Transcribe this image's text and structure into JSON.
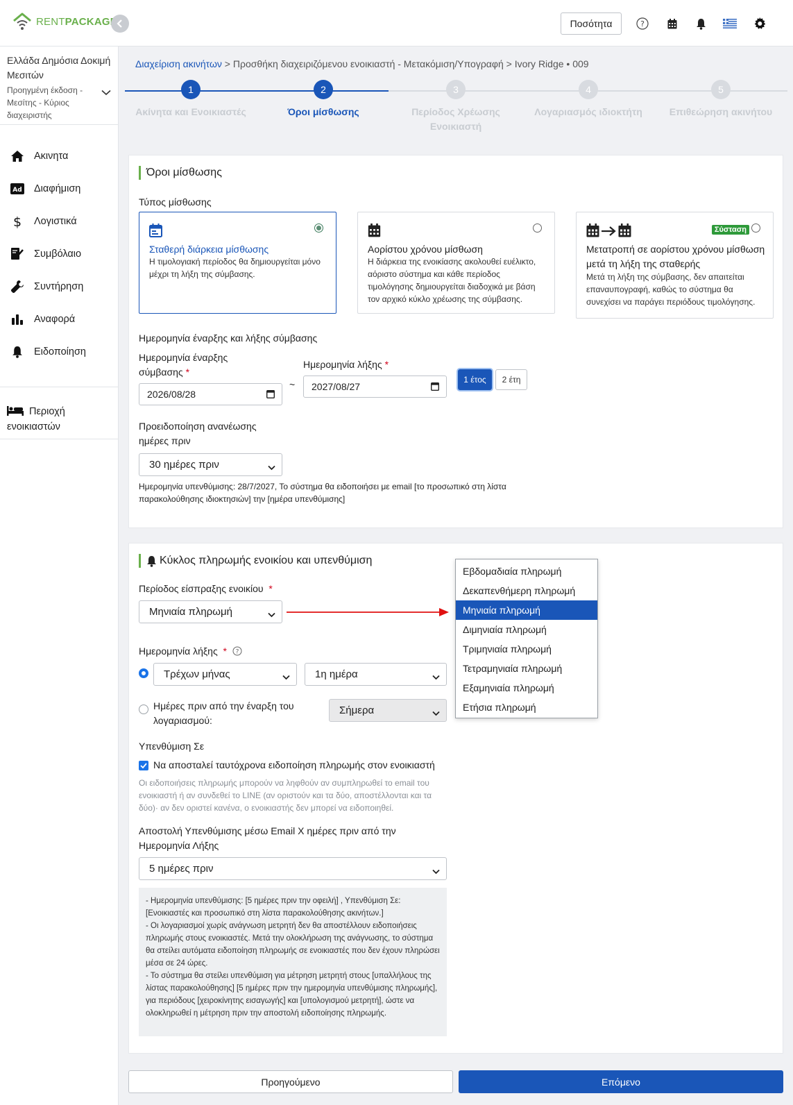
{
  "brand": {
    "rent": "RENT",
    "package": "PACKAGE"
  },
  "topbar": {
    "quantity_label": "Ποσότητα"
  },
  "sidebar": {
    "org_name": "Ελλάδα Δημόσια Δοκιμή Μεσιτών",
    "org_role": "Προηγμένη έκδοση - Μεσίτης - Κύριος διαχειριστής",
    "items": [
      {
        "label": "Ακινητα",
        "icon": "home-icon"
      },
      {
        "label": "Διαφήμιση",
        "icon": "ad-icon"
      },
      {
        "label": "Λογιστικά",
        "icon": "dollar-icon"
      },
      {
        "label": "Συμβόλαιο",
        "icon": "contract-icon"
      },
      {
        "label": "Συντήρηση",
        "icon": "wrench-icon"
      },
      {
        "label": "Αναφορά",
        "icon": "chart-icon"
      },
      {
        "label": "Ειδοποίηση",
        "icon": "bell-icon"
      }
    ],
    "tenant_area": "Περιοχή ενοικιαστών"
  },
  "breadcrumb": {
    "root": "Διαχείριση ακινήτων",
    "sep1": ">",
    "middle": "Προσθήκη διαχειριζόμενου ενοικιαστή - Μετακόμιση/Υπογραφή",
    "sep2": ">",
    "current": "Ivory Ridge • 009"
  },
  "stepper": {
    "steps": [
      {
        "number": "1",
        "label": "Ακίνητα και Ενοικιαστές"
      },
      {
        "number": "2",
        "label": "Όροι μίσθωσης"
      },
      {
        "number": "3",
        "label": "Περίοδος Χρέωσης Ενοικιαστή"
      },
      {
        "number": "4",
        "label": "Λογαριασμός ιδιοκτήτη"
      },
      {
        "number": "5",
        "label": "Επιθεώρηση ακινήτου"
      }
    ]
  },
  "lease": {
    "title": "Όροι μίσθωσης",
    "type_label": "Τύπος μίσθωσης",
    "options": [
      {
        "title": "Σταθερή διάρκεια μίσθωσης",
        "desc": "Η τιμολογιακή περίοδος θα δημιουργείται μόνο μέχρι τη λήξη της σύμβασης."
      },
      {
        "title": "Αορίστου χρόνου μίσθωση",
        "desc": "Η διάρκεια της ενοικίασης ακολουθεί ευέλικτο, αόριστο σύστημα και κάθε περίοδος τιμολόγησης δημιουργείται διαδοχικά με βάση τον αρχικό κύκλο χρέωσης της σύμβασης."
      },
      {
        "title": "Μετατροπή σε αορίστου χρόνου μίσθωση μετά τη λήξη της σταθερής",
        "desc": "Μετά τη λήξη της σύμβασης, δεν απαιτείται επαναυπογραφή, καθώς το σύστημα θα συνεχίσει να παράγει περιόδους τιμολόγησης.",
        "badge": "Σύσταση"
      }
    ],
    "dates_heading": "Ημερομηνία έναρξης και λήξης σύμβασης",
    "start_label": "Ημερομηνία έναρξης σύμβασης",
    "start_value": "2026/08/28",
    "tilde": "~",
    "end_label": "Ημερομηνία λήξης",
    "end_value": "2027/08/27",
    "year1": "1 έτος",
    "year2": "2 έτη",
    "renewal_label": "Προειδοποίηση ανανέωσης ημέρες πριν",
    "renewal_value": "30 ημέρες πριν",
    "renewal_note": "Ημερομηνία υπενθύμισης: 28/7/2027, Το σύστημα θα ειδοποιήσει με email [το προσωπικό στη λίστα παρακολούθησης ιδιοκτησιών] την [ημέρα υπενθύμισης]"
  },
  "payment": {
    "title": "Κύκλος πληρωμής ενοικίου και υπενθύμιση",
    "period_label": "Περίοδος είσπραξης ενοικίου",
    "period_value": "Μηνιαία πληρωμή",
    "due_label": "Ημερομηνία λήξης",
    "month_value": "Τρέχων μήνας",
    "day_value": "1η ημέρα",
    "before_label": "Ημέρες πριν από την έναρξη του λογαριασμού:",
    "before_value": "Σήμερα",
    "remind_label": "Υπενθύμιση Σε",
    "check_label": "Να αποσταλεί ταυτόχρονα ειδοποίηση πληρωμής στον ενοικιαστή",
    "check_note": "Οι ειδοποιήσεις πληρωμής μπορούν να ληφθούν αν συμπληρωθεί το email του ενοικιαστή ή αν συνδεθεί το LINE (αν οριστούν και τα δύο, αποστέλλονται και τα δύο)· αν δεν οριστεί κανένα, ο ενοικιαστής δεν μπορεί να ειδοποιηθεί.",
    "email_label": "Αποστολή Υπενθύμισης μέσω Email Χ ημέρες πριν από την Ημερομηνία Λήξης",
    "email_value": "5 ημέρες πριν",
    "info": [
      "- Ημερομηνία υπενθύμισης: [5 ημέρες πριν την οφειλή] , Υπενθύμιση Σε: [Ενοικιαστές και προσωπικό στη λίστα παρακολούθησης ακινήτων.]",
      "- Οι λογαριασμοί χωρίς ανάγνωση μετρητή δεν θα αποστέλλουν ειδοποιήσεις πληρωμής στους ενοικιαστές. Μετά την ολοκλήρωση της ανάγνωσης, το σύστημα θα στείλει αυτόματα ειδοποίηση πληρωμής σε ενοικιαστές που δεν έχουν πληρώσει μέσα σε 24 ώρες.",
      "- Το σύστημα θα στείλει υπενθύμιση για μέτρηση μετρητή στους [υπαλλήλους της λίστας παρακολούθησης] [5 ημέρες πριν την ημερομηνία υπενθύμισης πληρωμής], για περιόδους [χειροκίνητης εισαγωγής] και [υπολογισμού μετρητή], ώστε να ολοκληρωθεί η μέτρηση πριν την αποστολή ειδοποίησης πληρωμής."
    ]
  },
  "dropdown": {
    "options": [
      "Εβδομαδιαία πληρωμή",
      "Δεκαπενθήμερη πληρωμή",
      "Μηνιαία πληρωμή",
      "Διμηνιαία πληρωμή",
      "Τριμηνιαία πληρωμή",
      "Τετραμηνιαία πληρωμή",
      "Εξαμηνιαία πληρωμή",
      "Ετήσια πληρωμή"
    ],
    "selected": "Μηνιαία πληρωμή"
  },
  "footer": {
    "prev": "Προηγούμενο",
    "next": "Επόμενο"
  },
  "colors": {
    "primary": "#1a56b8",
    "brand_green": "#6ab04c",
    "arrow_red": "#e01010"
  }
}
